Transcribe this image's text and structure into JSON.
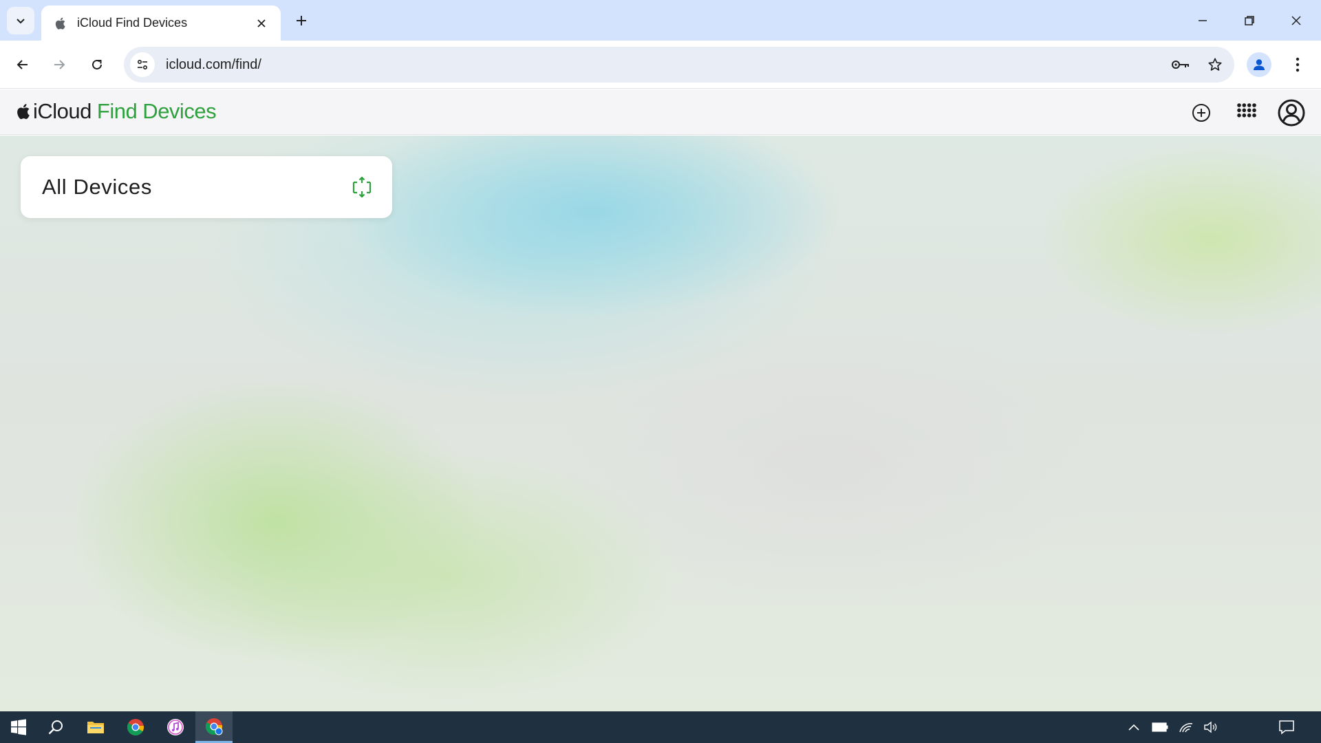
{
  "browser": {
    "tab_title": "iCloud Find Devices",
    "url": "icloud.com/find/"
  },
  "app": {
    "brand_icloud": "iCloud",
    "brand_section": "Find Devices",
    "accent_color": "#2ea13e"
  },
  "devices_panel": {
    "title": "All Devices"
  },
  "taskbar": {
    "apps": [
      "start",
      "search",
      "file-explorer",
      "chrome",
      "itunes",
      "chrome-active"
    ]
  }
}
